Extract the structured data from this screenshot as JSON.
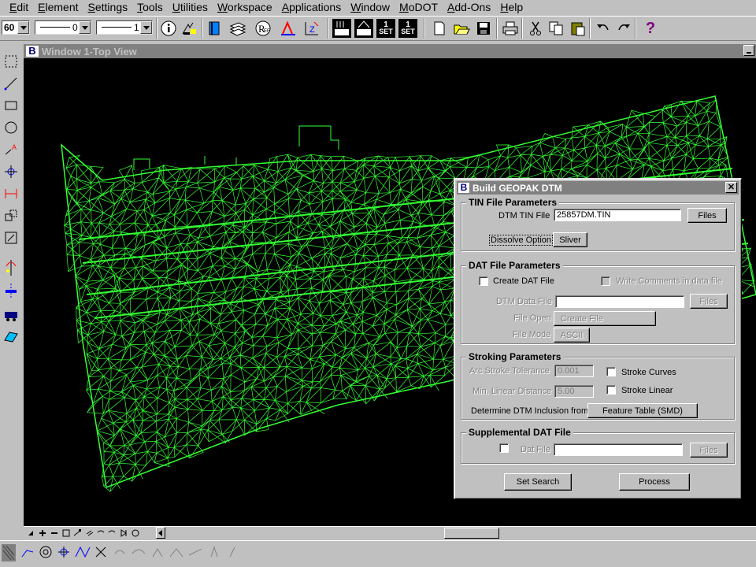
{
  "menu": [
    "Edit",
    "Element",
    "Settings",
    "Tools",
    "Utilities",
    "Workspace",
    "Applications",
    "Window",
    "MoDOT",
    "Add-Ons",
    "Help"
  ],
  "toolbar": {
    "color_value": "60",
    "line_style_value": "0",
    "line_weight_value": "1",
    "help_glyph": "?",
    "icons": [
      "info-icon",
      "element-select-icon",
      "book-icon",
      "layers-icon",
      "reference-icon",
      "ref-files-icon",
      "level-icon",
      "text-z-icon",
      "settings-icon",
      "new-file-icon",
      "open-file-icon",
      "save-icon",
      "print-icon",
      "cut-icon",
      "copy-icon",
      "paste-icon",
      "undo-icon",
      "redo-icon",
      "help-icon"
    ],
    "ref_label": "Ref",
    "set_label": "SET"
  },
  "view": {
    "title": "Window 1-Top View",
    "wire_color": "#33ff33"
  },
  "dialog": {
    "title": "Build GEOPAK DTM",
    "close_glyph": "✕",
    "tin": {
      "group": "TIN File Parameters",
      "file_label": "DTM TIN File",
      "file_value": "25857DM.TIN",
      "files_button": "Files",
      "dissolve_label": "Dissolve Option",
      "dissolve_value": "Sliver"
    },
    "dat": {
      "group": "DAT File Parameters",
      "create_label": "Create DAT File",
      "comments_label": "Write Comments in data file",
      "data_file_label": "DTM Data File",
      "data_file_value": "",
      "files_button": "Files",
      "file_open_label": "File Open",
      "file_open_value": "Create File",
      "file_mode_label": "File Mode",
      "file_mode_value": "ASCII"
    },
    "stroking": {
      "group": "Stroking Parameters",
      "arc_label": "Arc Stroke Tolerance",
      "arc_value": "0.001",
      "stroke_curves_label": "Stroke Curves",
      "min_linear_label": "Min. Linear Distance",
      "min_linear_value": "5.00",
      "stroke_linear_label": "Stroke Linear",
      "inclusion_label": "Determine DTM Inclusion from",
      "inclusion_value": "Feature Table (SMD)"
    },
    "supplemental": {
      "group": "Supplemental DAT File",
      "dat_file_label": "Dat File",
      "dat_file_value": "",
      "files_button": "Files"
    },
    "set_search_button": "Set Search",
    "process_button": "Process"
  }
}
